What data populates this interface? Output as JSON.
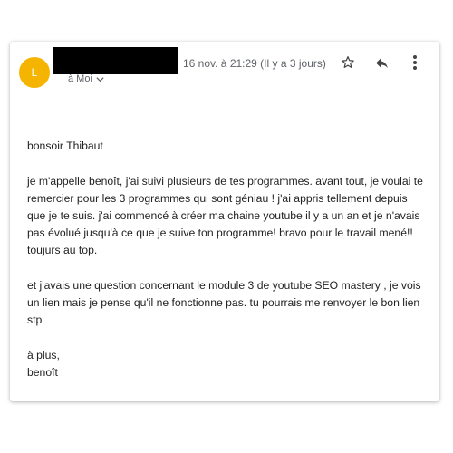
{
  "sender": {
    "avatar_letter": "L",
    "avatar_color": "#f5b400"
  },
  "header": {
    "recipient_label": "à Moi",
    "date": "16 nov. à 21:29 (Il y a 3 jours)"
  },
  "actions": {
    "star_icon": "star-icon",
    "reply_icon": "reply-icon",
    "more_icon": "more-vert-icon"
  },
  "message": {
    "greeting": "bonsoir Thibaut",
    "paragraph1": "je m'appelle benoît, j'ai suivi plusieurs de tes programmes. avant tout, je voulai te remercier pour les 3 programmes qui sont géniau ! j'ai appris tellement depuis que je te suis. j'ai commencé à créer ma chaine youtube il y a un an et je n'avais pas évolué jusqu'à ce que je suive ton programme! bravo pour le travail mené!! toujurs au top.",
    "paragraph2": "et j'avais une question concernant le module 3 de youtube SEO mastery , je vois un lien mais je pense qu'il ne fonctionne pas. tu pourrais me renvoyer le bon lien stp",
    "signoff": "à plus,",
    "signature": "benoît"
  }
}
